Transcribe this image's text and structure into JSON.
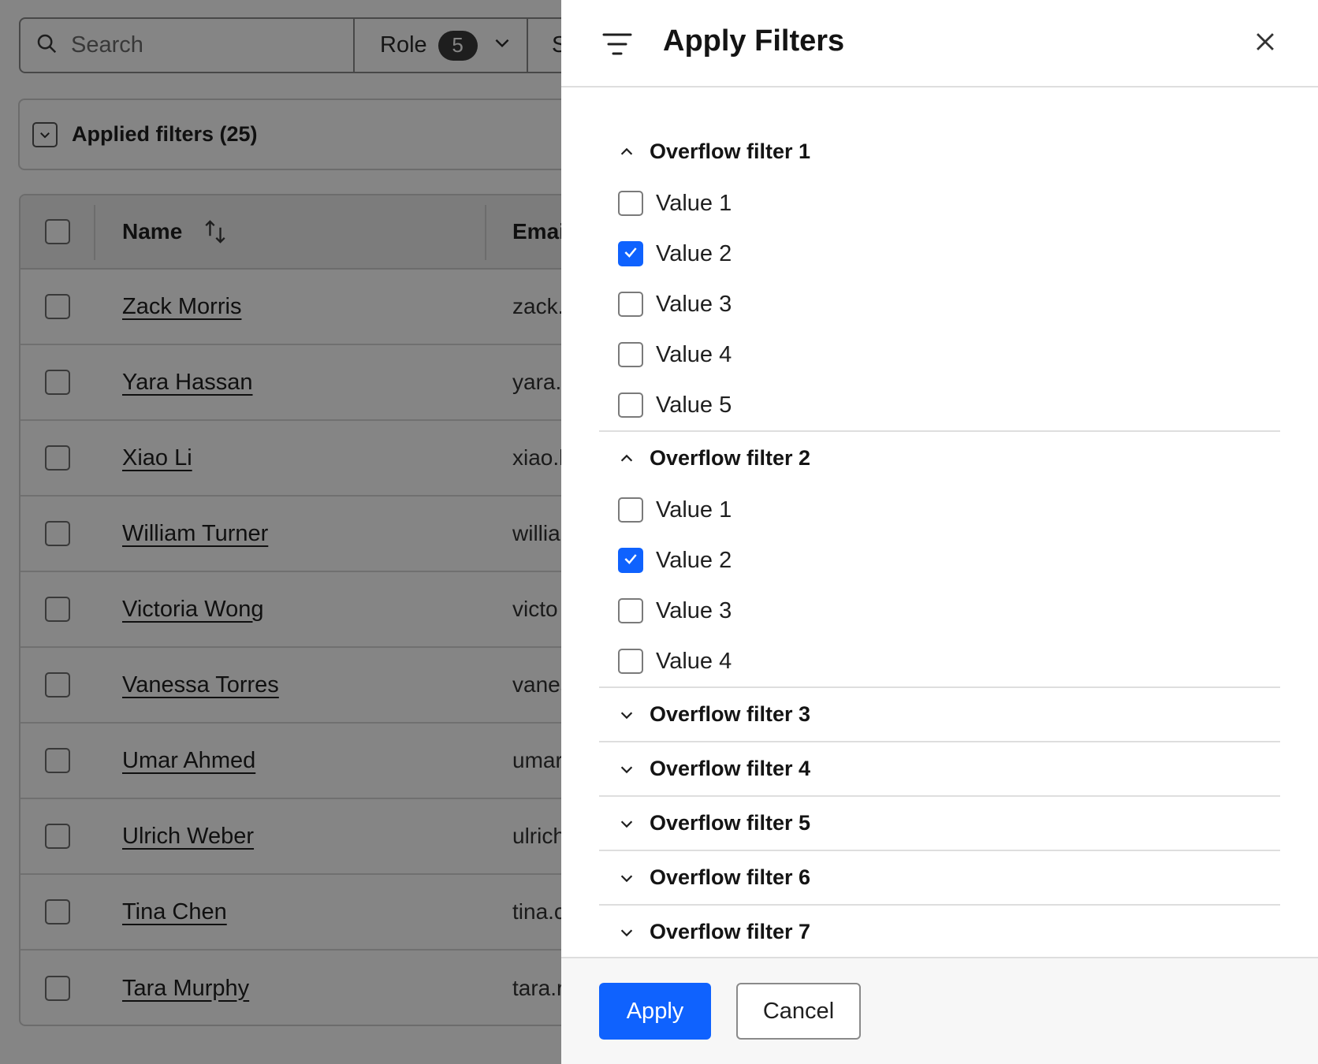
{
  "toolbar": {
    "search_placeholder": "Search",
    "role_label": "Role",
    "role_count": "5",
    "next_filter_partial": "S"
  },
  "applied_filters": {
    "label": "Applied filters (25)"
  },
  "table": {
    "columns": {
      "name": "Name",
      "email_partial": "Emai"
    },
    "rows": [
      {
        "name": "Zack Morris",
        "email": "zack."
      },
      {
        "name": "Yara Hassan",
        "email": "yara."
      },
      {
        "name": "Xiao Li",
        "email": "xiao.l"
      },
      {
        "name": "William Turner",
        "email": "willia"
      },
      {
        "name": "Victoria Wong",
        "email": "victo"
      },
      {
        "name": "Vanessa Torres",
        "email": "vanes"
      },
      {
        "name": "Umar Ahmed",
        "email": "umar"
      },
      {
        "name": "Ulrich Weber",
        "email": "ulrich"
      },
      {
        "name": "Tina Chen",
        "email": "tina.c"
      },
      {
        "name": "Tara Murphy",
        "email": "tara.r"
      }
    ]
  },
  "drawer": {
    "title": "Apply Filters",
    "groups": [
      {
        "label": "Overflow filter 1",
        "expanded": true,
        "options": [
          {
            "label": "Value 1",
            "checked": false
          },
          {
            "label": "Value 2",
            "checked": true
          },
          {
            "label": "Value 3",
            "checked": false
          },
          {
            "label": "Value 4",
            "checked": false
          },
          {
            "label": "Value 5",
            "checked": false
          }
        ]
      },
      {
        "label": "Overflow filter 2",
        "expanded": true,
        "options": [
          {
            "label": "Value 1",
            "checked": false
          },
          {
            "label": "Value 2",
            "checked": true
          },
          {
            "label": "Value 3",
            "checked": false
          },
          {
            "label": "Value 4",
            "checked": false
          }
        ]
      },
      {
        "label": "Overflow filter 3",
        "expanded": false,
        "options": []
      },
      {
        "label": "Overflow filter 4",
        "expanded": false,
        "options": []
      },
      {
        "label": "Overflow filter 5",
        "expanded": false,
        "options": []
      },
      {
        "label": "Overflow filter 6",
        "expanded": false,
        "options": []
      },
      {
        "label": "Overflow filter 7",
        "expanded": false,
        "options": []
      }
    ],
    "apply_label": "Apply",
    "cancel_label": "Cancel"
  },
  "colors": {
    "primary": "#0f62fe",
    "overlay": "rgba(0,0,0,0.48)"
  },
  "icons": {
    "search": "search-icon",
    "chevron_down": "chevron-down-icon",
    "chevron_up": "chevron-up-icon",
    "sort": "sort-icon",
    "filter": "filter-icon",
    "close": "close-icon",
    "checkmark": "checkmark-icon"
  }
}
